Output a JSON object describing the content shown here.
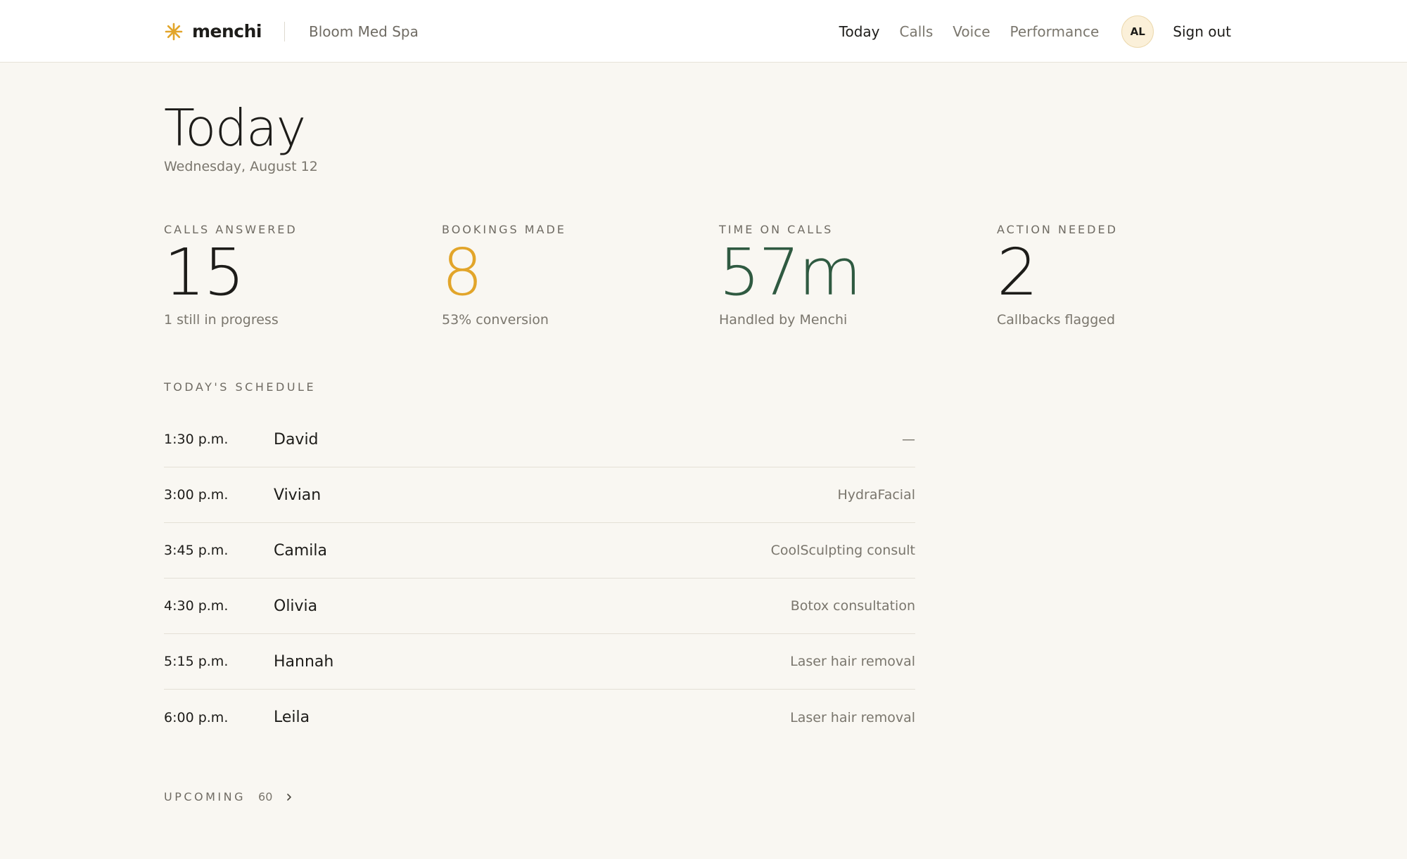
{
  "header": {
    "brand": "menchi",
    "org": "Bloom Med Spa",
    "nav": [
      {
        "label": "Today",
        "active": true
      },
      {
        "label": "Calls",
        "active": false
      },
      {
        "label": "Voice",
        "active": false
      },
      {
        "label": "Performance",
        "active": false
      }
    ],
    "avatar_initials": "AL",
    "signout_label": "Sign out",
    "brand_icon": "asterisk-icon",
    "brand_color": "#e2a52a"
  },
  "page": {
    "title": "Today",
    "date": "Wednesday, August 12"
  },
  "stats": [
    {
      "label": "CALLS ANSWERED",
      "value": "15",
      "sub": "1 still in progress",
      "color": "#1d1c19"
    },
    {
      "label": "BOOKINGS MADE",
      "value": "8",
      "sub": "53% conversion",
      "color": "#e2a52a"
    },
    {
      "label": "TIME ON CALLS",
      "value": "57m",
      "sub": "Handled by Menchi",
      "color": "#2f5a41"
    },
    {
      "label": "ACTION NEEDED",
      "value": "2",
      "sub": "Callbacks flagged",
      "color": "#1d1c19"
    }
  ],
  "schedule": {
    "label": "TODAY'S SCHEDULE",
    "rows": [
      {
        "time": "1:30 p.m.",
        "name": "David",
        "service": "—"
      },
      {
        "time": "3:00 p.m.",
        "name": "Vivian",
        "service": "HydraFacial"
      },
      {
        "time": "3:45 p.m.",
        "name": "Camila",
        "service": "CoolSculpting consult"
      },
      {
        "time": "4:30 p.m.",
        "name": "Olivia",
        "service": "Botox consultation"
      },
      {
        "time": "5:15 p.m.",
        "name": "Hannah",
        "service": "Laser hair removal"
      },
      {
        "time": "6:00 p.m.",
        "name": "Leila",
        "service": "Laser hair removal"
      }
    ]
  },
  "upcoming": {
    "label": "UPCOMING",
    "count": "60",
    "icon": "chevron-right-icon"
  }
}
